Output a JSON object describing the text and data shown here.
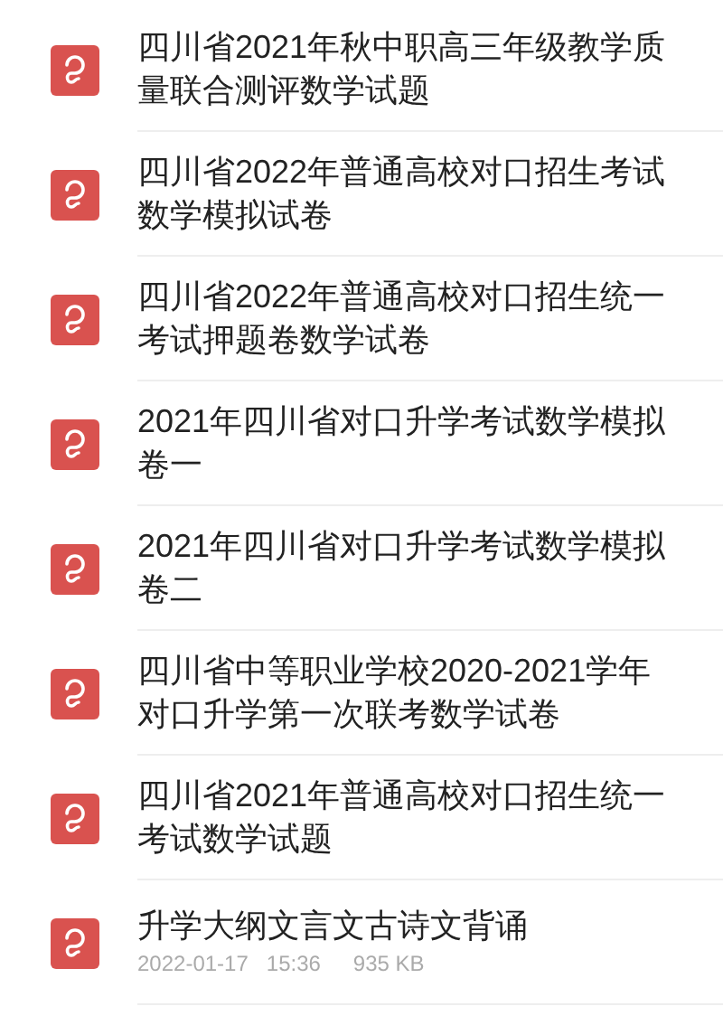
{
  "files": [
    {
      "title_lines": [
        "四川省2021年秋中职高三年级教学质",
        "量联合测评数学试题"
      ]
    },
    {
      "title_lines": [
        "四川省2022年普通高校对口招生考试",
        "数学模拟试卷"
      ]
    },
    {
      "title_lines": [
        "四川省2022年普通高校对口招生统一",
        "考试押题卷数学试卷"
      ]
    },
    {
      "title_lines": [
        "2021年四川省对口升学考试数学模拟",
        "卷一"
      ]
    },
    {
      "title_lines": [
        "2021年四川省对口升学考试数学模拟",
        "卷二"
      ]
    },
    {
      "title_lines": [
        "四川省中等职业学校2020-2021学年",
        "对口升学第一次联考数学试卷"
      ]
    },
    {
      "title_lines": [
        "四川省2021年普通高校对口招生统一",
        "考试数学试题"
      ]
    },
    {
      "title_lines": [
        "升学大纲文言文古诗文背诵"
      ],
      "date": "2022-01-17",
      "time": "15:36",
      "size": "935 KB"
    }
  ]
}
